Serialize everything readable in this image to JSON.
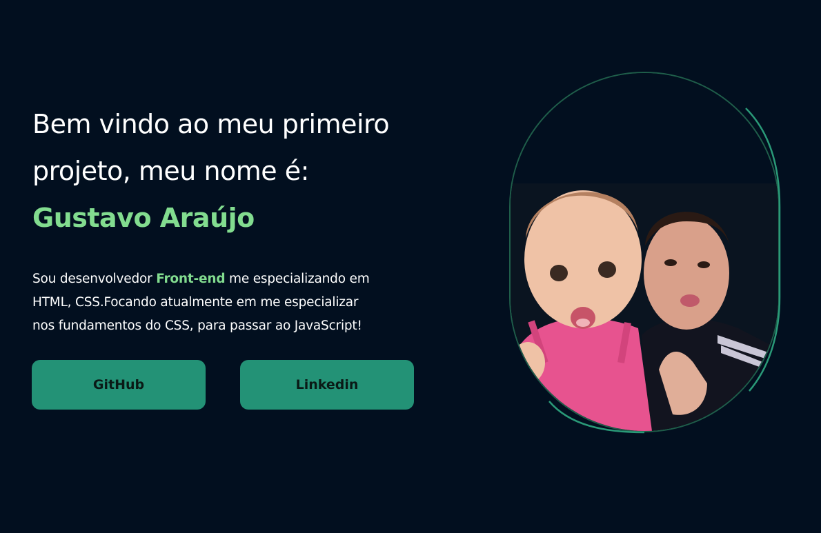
{
  "hero": {
    "heading_line1": "Bem vindo ao meu primeiro",
    "heading_line2": "projeto, meu nome é:",
    "name": "Gustavo Araújo",
    "intro_line1_prefix": "Sou desenvolvedor ",
    "intro_line1_highlight": "Front-end",
    "intro_line1_suffix": " me especializando em",
    "intro_line2": "HTML, CSS.Focando atualmente em me especializar",
    "intro_line3": "nos fundamentos do CSS, para passar ao JavaScript!"
  },
  "buttons": {
    "github_label": "GitHub",
    "linkedin_label": "Linkedin"
  },
  "photo": {
    "icon": "profile-photo"
  },
  "colors": {
    "background": "#020f1f",
    "accent_green": "#82dc8f",
    "button_bg": "#239276",
    "frame_border": "#1f5e4a"
  }
}
